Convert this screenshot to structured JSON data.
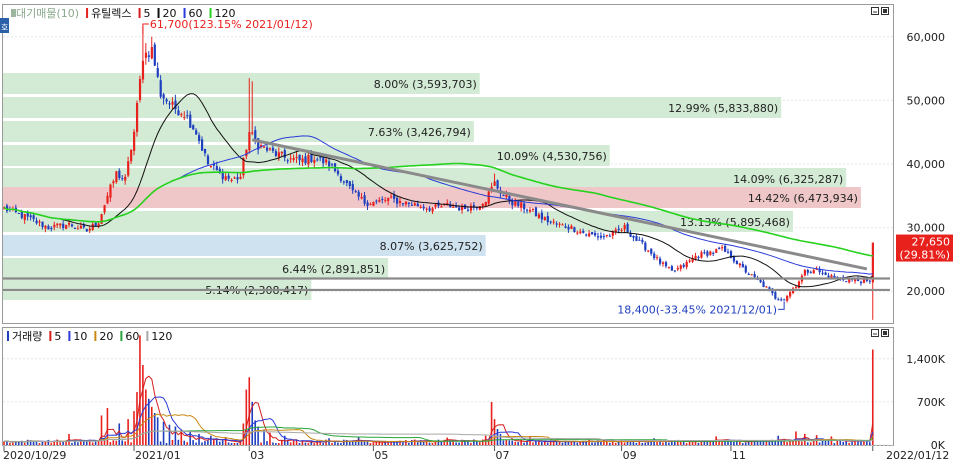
{
  "colors": {
    "up": "#e8211d",
    "down": "#1f3fbf",
    "ma5": "#000000",
    "ma20": "#2a3bd8",
    "ma60": "#27d21f",
    "ma120": "#9b9b9b",
    "vol5": "#d41e1e",
    "vol10": "#2a3bd8",
    "vol20": "#c98a14",
    "vol60": "#2aa43a",
    "vol120": "#a8a8a8",
    "band_green": "#d3ebd5",
    "band_red": "#efc7c8",
    "band_blue": "#cfe2ef",
    "trend": "#8a8a8a"
  },
  "legend": {
    "price_items": [
      {
        "text": "대기매물(10)",
        "color": "#9db69f",
        "marker": "square"
      },
      {
        "text": "유틸렉스",
        "color": "#e8211d",
        "marker": "bar"
      },
      {
        "text": "5",
        "color": "#d41e1e",
        "marker": "bar"
      },
      {
        "text": "20",
        "color": "#111111",
        "marker": "bar"
      },
      {
        "text": "60",
        "color": "#2a3bd8",
        "marker": "bar"
      },
      {
        "text": "120",
        "color": "#27d21f",
        "marker": "bar"
      }
    ],
    "volume_items": [
      {
        "text": "거래량",
        "color": "#1f3fbf",
        "marker": "bar"
      },
      {
        "text": "5",
        "color": "#d41e1e",
        "marker": "bar"
      },
      {
        "text": "10",
        "color": "#2a3bd8",
        "marker": "bar"
      },
      {
        "text": "20",
        "color": "#c98a14",
        "marker": "bar"
      },
      {
        "text": "60",
        "color": "#2aa43a",
        "marker": "bar"
      },
      {
        "text": "120",
        "color": "#a8a8a8",
        "marker": "bar"
      }
    ],
    "corner_icon": "호"
  },
  "chart_data": [
    {
      "type": "candlestick",
      "name": "유틸렉스",
      "x_range": [
        "2020/10/29",
        "2022/01/12"
      ],
      "ylim": [
        15000,
        65000
      ],
      "y_ticks": [
        {
          "value": 20000,
          "label": "20,000"
        },
        {
          "value": 30000,
          "label": "30,000"
        },
        {
          "value": 40000,
          "label": "40,000"
        },
        {
          "value": 50000,
          "label": "50,000"
        },
        {
          "value": 60000,
          "label": "60,000"
        }
      ],
      "x_ticks": [
        {
          "i": 0,
          "label": "2020/10/29"
        },
        {
          "i": 44,
          "label": "2021/01"
        },
        {
          "i": 83,
          "label": "03"
        },
        {
          "i": 125,
          "label": "05"
        },
        {
          "i": 166,
          "label": "07"
        },
        {
          "i": 209,
          "label": "09"
        },
        {
          "i": 246,
          "label": "11"
        },
        {
          "i": 294,
          "label": "2022/01/12"
        }
      ],
      "keypoints": [
        [
          0,
          33000
        ],
        [
          8,
          31500
        ],
        [
          15,
          30000
        ],
        [
          22,
          30500
        ],
        [
          28,
          29500
        ],
        [
          32,
          31000
        ],
        [
          35,
          35000
        ],
        [
          38,
          38500
        ],
        [
          41,
          37500
        ],
        [
          44,
          45000
        ],
        [
          47,
          57000
        ],
        [
          50,
          58000
        ],
        [
          53,
          51000
        ],
        [
          57,
          49000
        ],
        [
          61,
          48000
        ],
        [
          65,
          45000
        ],
        [
          69,
          40000
        ],
        [
          73,
          38500
        ],
        [
          77,
          37500
        ],
        [
          80,
          38000
        ],
        [
          83,
          45000
        ],
        [
          86,
          43000
        ],
        [
          90,
          42000
        ],
        [
          95,
          41000
        ],
        [
          100,
          40500
        ],
        [
          105,
          41000
        ],
        [
          110,
          40000
        ],
        [
          114,
          38000
        ],
        [
          118,
          35500
        ],
        [
          122,
          34000
        ],
        [
          126,
          34000
        ],
        [
          130,
          34500
        ],
        [
          135,
          34000
        ],
        [
          140,
          33500
        ],
        [
          145,
          33000
        ],
        [
          150,
          33500
        ],
        [
          155,
          33000
        ],
        [
          160,
          33500
        ],
        [
          163,
          34500
        ],
        [
          166,
          37000
        ],
        [
          169,
          35000
        ],
        [
          172,
          34000
        ],
        [
          177,
          33000
        ],
        [
          182,
          31500
        ],
        [
          187,
          30500
        ],
        [
          192,
          30000
        ],
        [
          197,
          29000
        ],
        [
          202,
          28500
        ],
        [
          206,
          29000
        ],
        [
          210,
          30000
        ],
        [
          214,
          28000
        ],
        [
          218,
          26500
        ],
        [
          222,
          24500
        ],
        [
          226,
          23000
        ],
        [
          230,
          24000
        ],
        [
          234,
          25500
        ],
        [
          238,
          26000
        ],
        [
          243,
          26500
        ],
        [
          246,
          25500
        ],
        [
          250,
          23500
        ],
        [
          254,
          22000
        ],
        [
          258,
          20500
        ],
        [
          261,
          19000
        ],
        [
          264,
          18800
        ],
        [
          268,
          21000
        ],
        [
          271,
          23000
        ],
        [
          274,
          23500
        ],
        [
          278,
          22500
        ],
        [
          282,
          22000
        ],
        [
          286,
          21800
        ],
        [
          290,
          21600
        ],
        [
          291,
          21600
        ],
        [
          292,
          21400
        ],
        [
          293,
          21300
        ],
        [
          294,
          27650
        ]
      ],
      "spikes": [
        {
          "i": 47,
          "high": 61700
        },
        {
          "i": 48,
          "high": 59000
        },
        {
          "i": 50,
          "high": 60000
        },
        {
          "i": 83,
          "high": 53500
        },
        {
          "i": 84,
          "high": 53000
        },
        {
          "i": 166,
          "high": 38500
        },
        {
          "i": 294,
          "high": 27650
        }
      ],
      "resistance_bands": [
        {
          "price": 46500,
          "x0": 0,
          "x1": 161,
          "label": "8.00% (3,593,703)",
          "color": "green"
        },
        {
          "price": 42500,
          "x0": 0,
          "x1": 263,
          "label": "12.99% (5,833,880)",
          "color": "green"
        },
        {
          "price": 38500,
          "x0": 0,
          "x1": 159,
          "label": "7.63% (3,426,794)",
          "color": "green"
        },
        {
          "price": 34500,
          "x0": 0,
          "x1": 205,
          "label": "10.09% (4,530,756)",
          "color": "green"
        },
        {
          "price": 30500,
          "x0": 0,
          "x1": 285,
          "label": "14.09% (6,325,287)",
          "color": "green"
        },
        {
          "price": 26500,
          "x0": 0,
          "x1": 290,
          "label": "14.42% (6,473,934)",
          "color": "red"
        },
        {
          "price": 22500,
          "x0": 0,
          "x1": 267,
          "label": "13.13% (5,895,468)",
          "color": "green"
        },
        {
          "price": 18500,
          "x0": 0,
          "x1": 163,
          "label": "8.07% (3,625,752)",
          "color": "blue"
        },
        {
          "price": 14500,
          "x0": 0,
          "x1": 130,
          "label": "6.44% (2,891,851)",
          "color": "green"
        },
        {
          "price": 10500,
          "x0": 0,
          "x1": 104,
          "label": "5.14% (2,308,417)",
          "color": "green"
        }
      ],
      "trendline": {
        "p1": [
          84,
          43800
        ],
        "p2": [
          292,
          23500
        ]
      },
      "support_lines": [
        22000,
        20200
      ],
      "annotations": {
        "high": {
          "i": 47,
          "price": 61700,
          "text": "61,700(123.15% 2021/01/12)"
        },
        "low": {
          "i": 264,
          "price": 18400,
          "text": "18,400(-33.45% 2021/12/01)"
        }
      },
      "last_price": {
        "text": "27,650",
        "change": "(29.81%)"
      }
    },
    {
      "type": "bar",
      "name": "거래량",
      "ylim": [
        0,
        1900000
      ],
      "y_ticks": [
        {
          "value": 0,
          "label": "0K"
        },
        {
          "value": 700000,
          "label": "700K"
        },
        {
          "value": 1400000,
          "label": "1,400K"
        }
      ],
      "base_volume": 60000,
      "spikes": [
        {
          "i": 22,
          "v": 180000
        },
        {
          "i": 33,
          "v": 480000
        },
        {
          "i": 35,
          "v": 600000
        },
        {
          "i": 39,
          "v": 350000
        },
        {
          "i": 42,
          "v": 420000
        },
        {
          "i": 44,
          "v": 550000
        },
        {
          "i": 45,
          "v": 860000
        },
        {
          "i": 46,
          "v": 1780000
        },
        {
          "i": 47,
          "v": 1300000
        },
        {
          "i": 48,
          "v": 900000
        },
        {
          "i": 49,
          "v": 750000
        },
        {
          "i": 50,
          "v": 620000
        },
        {
          "i": 51,
          "v": 520000
        },
        {
          "i": 52,
          "v": 450000
        },
        {
          "i": 54,
          "v": 380000
        },
        {
          "i": 56,
          "v": 330000
        },
        {
          "i": 58,
          "v": 300000
        },
        {
          "i": 60,
          "v": 250000
        },
        {
          "i": 63,
          "v": 220000
        },
        {
          "i": 66,
          "v": 180000
        },
        {
          "i": 70,
          "v": 150000
        },
        {
          "i": 75,
          "v": 120000
        },
        {
          "i": 81,
          "v": 350000
        },
        {
          "i": 82,
          "v": 900000
        },
        {
          "i": 83,
          "v": 1100000
        },
        {
          "i": 84,
          "v": 700000
        },
        {
          "i": 85,
          "v": 400000
        },
        {
          "i": 86,
          "v": 300000
        },
        {
          "i": 88,
          "v": 250000
        },
        {
          "i": 90,
          "v": 200000
        },
        {
          "i": 95,
          "v": 150000
        },
        {
          "i": 110,
          "v": 110000
        },
        {
          "i": 120,
          "v": 130000
        },
        {
          "i": 150,
          "v": 120000
        },
        {
          "i": 163,
          "v": 150000
        },
        {
          "i": 165,
          "v": 700000
        },
        {
          "i": 166,
          "v": 420000
        },
        {
          "i": 167,
          "v": 260000
        },
        {
          "i": 168,
          "v": 180000
        },
        {
          "i": 178,
          "v": 130000
        },
        {
          "i": 220,
          "v": 110000
        },
        {
          "i": 241,
          "v": 140000
        },
        {
          "i": 262,
          "v": 150000
        },
        {
          "i": 268,
          "v": 220000
        },
        {
          "i": 271,
          "v": 180000
        },
        {
          "i": 275,
          "v": 160000
        },
        {
          "i": 280,
          "v": 140000
        },
        {
          "i": 294,
          "v": 1550000
        }
      ]
    }
  ]
}
